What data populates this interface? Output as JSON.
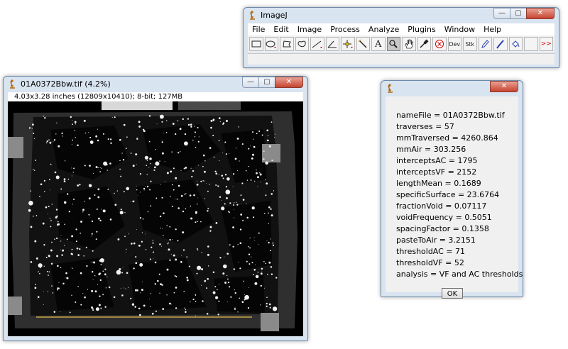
{
  "imagej_window": {
    "title": "ImageJ",
    "menus": [
      "File",
      "Edit",
      "Image",
      "Process",
      "Analyze",
      "Plugins",
      "Window",
      "Help"
    ],
    "tools": [
      {
        "name": "rectangle-tool-icon",
        "glyph": ""
      },
      {
        "name": "oval-tool-icon",
        "glyph": ""
      },
      {
        "name": "polygon-tool-icon",
        "glyph": ""
      },
      {
        "name": "freehand-tool-icon",
        "glyph": ""
      },
      {
        "name": "line-tool-icon",
        "glyph": ""
      },
      {
        "name": "angle-tool-icon",
        "glyph": ""
      },
      {
        "name": "point-tool-icon",
        "glyph": ""
      },
      {
        "name": "wand-tool-icon",
        "glyph": ""
      },
      {
        "name": "text-tool-icon",
        "glyph": "A"
      },
      {
        "name": "magnifier-tool-icon",
        "glyph": ""
      },
      {
        "name": "hand-tool-icon",
        "glyph": ""
      },
      {
        "name": "dropper-tool-icon",
        "glyph": ""
      },
      {
        "name": "stop-tool-icon",
        "glyph": ""
      },
      {
        "name": "developer-menu-icon",
        "glyph": "Dev"
      },
      {
        "name": "stack-menu-icon",
        "glyph": "Stk"
      },
      {
        "name": "pencil-tool-icon",
        "glyph": ""
      },
      {
        "name": "brush-tool-icon",
        "glyph": ""
      },
      {
        "name": "flood-fill-tool-icon",
        "glyph": ""
      },
      {
        "name": "blank-tool-icon",
        "glyph": ""
      },
      {
        "name": "more-tools-icon",
        "glyph": ">>"
      }
    ],
    "selected_tool": "magnifier-tool-icon"
  },
  "image_window": {
    "title": "01A0372Bbw.tif (4.2%)",
    "info": "4.03x3.28 inches (12809x10410); 8-bit; 127MB"
  },
  "results_window": {
    "title": "",
    "lines": [
      "nameFile = 01A0372Bbw.tif",
      "traverses = 57",
      "mmTraversed = 4260.864",
      "mmAir = 303.256",
      "interceptsAC = 1795",
      "interceptsVF = 2152",
      "lengthMean = 0.1689",
      "specificSurface = 23.6764",
      "fractionVoid = 0.07117",
      "voidFrequency = 0.5051",
      "spacingFactor = 0.1358",
      "pasteToAir = 3.2151",
      "thresholdAC = 71",
      "thresholdVF = 52",
      "analysis = VF and AC thresholds"
    ],
    "ok_label": "OK"
  },
  "window_controls": {
    "minimize": "—",
    "maximize": "▢",
    "close": "✕"
  },
  "colors": {
    "traverse_line": "#c9a441",
    "accent": "#d9e4f1",
    "close_red": "#c7432e"
  }
}
